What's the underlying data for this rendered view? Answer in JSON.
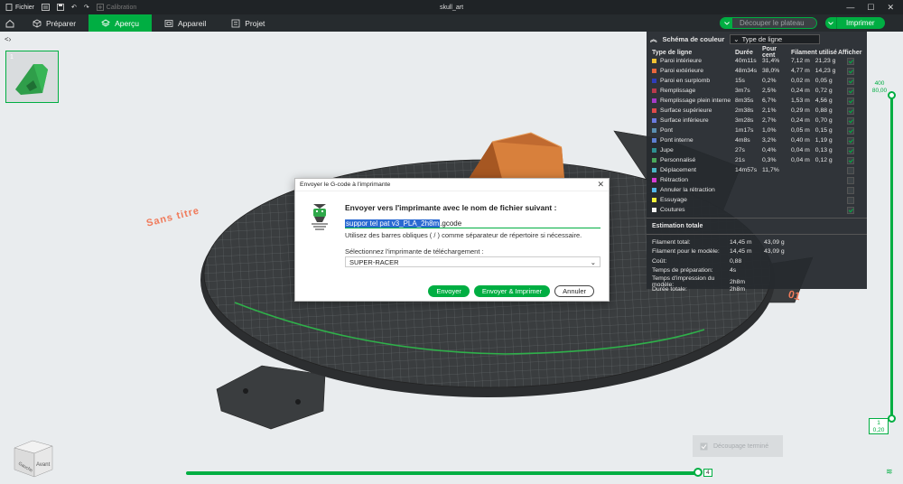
{
  "titlebar": {
    "file_label": "Fichier",
    "calibration_label": "Calibration",
    "window_title": "skull_art"
  },
  "tabs": [
    {
      "label": "Préparer",
      "icon": "cube-icon"
    },
    {
      "label": "Aperçu",
      "icon": "layers-icon",
      "active": true
    },
    {
      "label": "Appareil",
      "icon": "device-icon"
    },
    {
      "label": "Projet",
      "icon": "project-icon"
    }
  ],
  "actions": {
    "slice_label": "Découper le plateau",
    "print_label": "Imprimer"
  },
  "viewport": {
    "plate_name": "Sans titre",
    "plate_number": "01",
    "thumbnail_number": "1",
    "toast_text": "Découpage terminé",
    "cube_front": "Avant",
    "cube_side": "Gauche"
  },
  "legend": {
    "title": "Schéma de couleur",
    "select_value": "Type de ligne",
    "columns": [
      "Type de ligne",
      "Durée",
      "Pour cent",
      "Filament utilisé",
      "Afficher"
    ],
    "rows": [
      {
        "name": "Paroi intérieure",
        "color": "#f1c232",
        "time": "40m11s",
        "pct": "31,4%",
        "len": "7,12 m",
        "weight": "21,23 g",
        "show": true
      },
      {
        "name": "Paroi extérieure",
        "color": "#e8663d",
        "time": "48m34s",
        "pct": "38,0%",
        "len": "4,77 m",
        "weight": "14,23 g",
        "show": true
      },
      {
        "name": "Paroi en surplomb",
        "color": "#2f3dbb",
        "time": "15s",
        "pct": "0,2%",
        "len": "0,02 m",
        "weight": "0,05 g",
        "show": true
      },
      {
        "name": "Remplissage",
        "color": "#b93b4b",
        "time": "3m7s",
        "pct": "2,5%",
        "len": "0,24 m",
        "weight": "0,72 g",
        "show": true
      },
      {
        "name": "Remplissage plein interne",
        "color": "#a53bc8",
        "time": "8m35s",
        "pct": "6,7%",
        "len": "1,53 m",
        "weight": "4,56 g",
        "show": true
      },
      {
        "name": "Surface supérieure",
        "color": "#e04a4a",
        "time": "2m38s",
        "pct": "2,1%",
        "len": "0,29 m",
        "weight": "0,88 g",
        "show": true
      },
      {
        "name": "Surface inférieure",
        "color": "#6a7be0",
        "time": "3m28s",
        "pct": "2,7%",
        "len": "0,24 m",
        "weight": "0,70 g",
        "show": true
      },
      {
        "name": "Pont",
        "color": "#5a8fb0",
        "time": "1m17s",
        "pct": "1,0%",
        "len": "0,05 m",
        "weight": "0,15 g",
        "show": true
      },
      {
        "name": "Pont interne",
        "color": "#5e7fd1",
        "time": "4m8s",
        "pct": "3,2%",
        "len": "0,40 m",
        "weight": "1,19 g",
        "show": true
      },
      {
        "name": "Jupe",
        "color": "#2e8f8f",
        "time": "27s",
        "pct": "0,4%",
        "len": "0,04 m",
        "weight": "0,13 g",
        "show": true
      },
      {
        "name": "Personnalisé",
        "color": "#4aa85a",
        "time": "21s",
        "pct": "0,3%",
        "len": "0,04 m",
        "weight": "0,12 g",
        "show": true
      },
      {
        "name": "Déplacement",
        "color": "#48b5c4",
        "time": "14m57s",
        "pct": "11,7%",
        "len": "",
        "weight": "",
        "show": false
      },
      {
        "name": "Rétraction",
        "color": "#d63cd6",
        "time": "",
        "pct": "",
        "len": "",
        "weight": "",
        "show": false
      },
      {
        "name": "Annuler la rétraction",
        "color": "#52b7e8",
        "time": "",
        "pct": "",
        "len": "",
        "weight": "",
        "show": false
      },
      {
        "name": "Essuyage",
        "color": "#f3f23a",
        "time": "",
        "pct": "",
        "len": "",
        "weight": "",
        "show": false
      },
      {
        "name": "Coutures",
        "color": "#f2f2f2",
        "time": "",
        "pct": "",
        "len": "",
        "weight": "",
        "show": true
      }
    ],
    "estimate_title": "Estimation totale",
    "estimates": [
      {
        "label": "Filament total:",
        "v1": "14,45 m",
        "v2": "43,09 g"
      },
      {
        "label": "Filament pour le modèle:",
        "v1": "14,45 m",
        "v2": "43,09 g"
      },
      {
        "label": "Coût:",
        "v1": "0,88",
        "v2": ""
      },
      {
        "label": "Temps de préparation:",
        "v1": "4s",
        "v2": ""
      },
      {
        "label": "Temps d'impression du modèle:",
        "v1": "2h8m",
        "v2": ""
      },
      {
        "label": "Durée totale:",
        "v1": "2h8m",
        "v2": ""
      }
    ]
  },
  "layer_slider": {
    "top_layer": "400",
    "top_height": "80,00",
    "bottom_layer": "1",
    "bottom_height": "0,20"
  },
  "move_slider": {
    "value": "4"
  },
  "dialog": {
    "title": "Envoyer le G-code à l'imprimante",
    "heading": "Envoyer vers l'imprimante avec le nom de fichier suivant :",
    "filename_selected": "suppor tel pat v3_PLA_2h8m",
    "filename_ext": ".gcode",
    "hint": "Utilisez des barres obliques ( / ) comme séparateur de répertoire si nécessaire.",
    "printer_label": "Sélectionnez l'imprimante de téléchargement :",
    "printer_value": "SUPER-RACER",
    "send_label": "Envoyer",
    "send_print_label": "Envoyer & Imprimer",
    "cancel_label": "Annuler"
  }
}
